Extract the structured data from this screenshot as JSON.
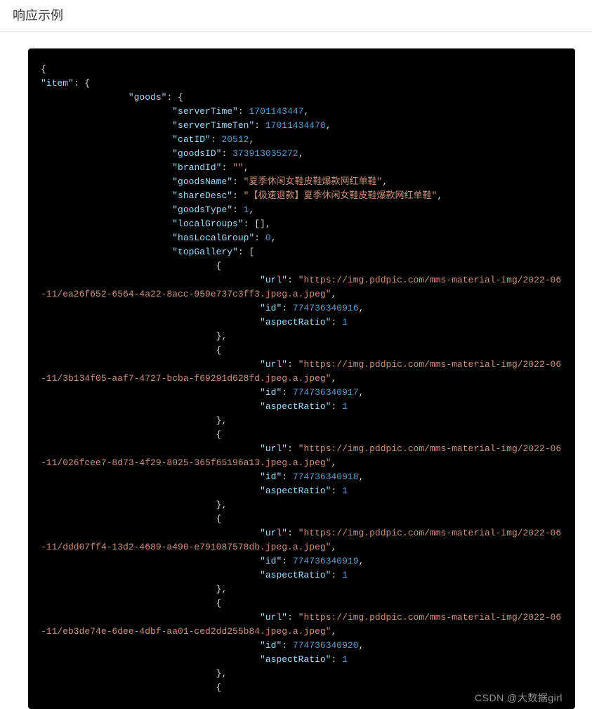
{
  "header": {
    "title": "响应示例"
  },
  "watermark": "CSDN @大数据girl",
  "code": {
    "item": {
      "goods": {
        "serverTime": 1701143447,
        "serverTimeTen": 17011434470,
        "catID": 20512,
        "goodsID": 373913035272,
        "brandId": "",
        "goodsName": "夏季休闲女鞋皮鞋爆款网红单鞋",
        "shareDesc": "【极速退款】夏季休闲女鞋皮鞋爆款网红单鞋",
        "goodsType": 1,
        "localGroups": [],
        "hasLocalGroup": 0,
        "topGallery": [
          {
            "url": "https://img.pddpic.com/mms-material-img/2022-06-11/ea26f652-6564-4a22-8acc-959e737c3ff3.jpeg.a.jpeg",
            "id": 774736340916,
            "aspectRatio": 1
          },
          {
            "url": "https://img.pddpic.com/mms-material-img/2022-06-11/3b134f05-aaf7-4727-bcba-f69291d628fd.jpeg.a.jpeg",
            "id": 774736340917,
            "aspectRatio": 1
          },
          {
            "url": "https://img.pddpic.com/mms-material-img/2022-06-11/026fcee7-8d73-4f29-8025-365f65196a13.jpeg.a.jpeg",
            "id": 774736340918,
            "aspectRatio": 1
          },
          {
            "url": "https://img.pddpic.com/mms-material-img/2022-06-11/ddd07ff4-13d2-4689-a490-e791087578db.jpeg.a.jpeg",
            "id": 774736340919,
            "aspectRatio": 1
          },
          {
            "url": "https://img.pddpic.com/mms-material-img/2022-06-11/eb3de74e-6dee-4dbf-aa01-ced2dd255b84.jpeg.a.jpeg",
            "id": 774736340920,
            "aspectRatio": 1
          }
        ]
      }
    }
  },
  "indent": {
    "i0": "",
    "i1": "                ",
    "i2": "                        ",
    "i3": "                                ",
    "i4": "                                        "
  }
}
